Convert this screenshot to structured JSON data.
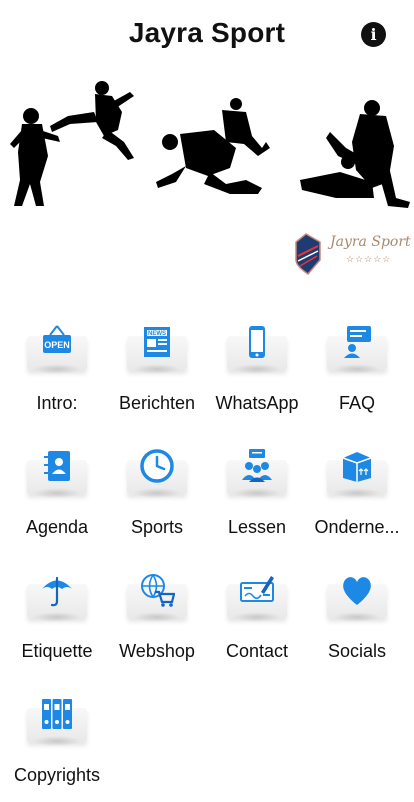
{
  "header": {
    "title": "Jayra Sport",
    "info_icon": "info-circle-icon",
    "info_glyph": "i"
  },
  "brand": {
    "name": "Jayra Sport",
    "stars": "☆☆☆☆☆"
  },
  "colors": {
    "accent": "#1e88e5",
    "dark_blue": "#1565c0",
    "silhouette": "#000000"
  },
  "menu": {
    "items": [
      {
        "label": "Intro:",
        "icon": "open-sign-icon"
      },
      {
        "label": "Berichten",
        "icon": "newspaper-icon"
      },
      {
        "label": "WhatsApp",
        "icon": "smartphone-icon"
      },
      {
        "label": "FAQ",
        "icon": "faq-chat-icon"
      },
      {
        "label": "Agenda",
        "icon": "contact-book-icon"
      },
      {
        "label": "Sports",
        "icon": "clock-icon"
      },
      {
        "label": "Lessen",
        "icon": "group-meeting-icon"
      },
      {
        "label": "Onderne...",
        "icon": "package-box-icon"
      },
      {
        "label": "Etiquette",
        "icon": "umbrella-icon"
      },
      {
        "label": "Webshop",
        "icon": "globe-cart-icon"
      },
      {
        "label": "Contact",
        "icon": "check-signature-icon"
      },
      {
        "label": "Socials",
        "icon": "heart-icon"
      },
      {
        "label": "Copyrights",
        "icon": "binders-icon"
      }
    ]
  }
}
